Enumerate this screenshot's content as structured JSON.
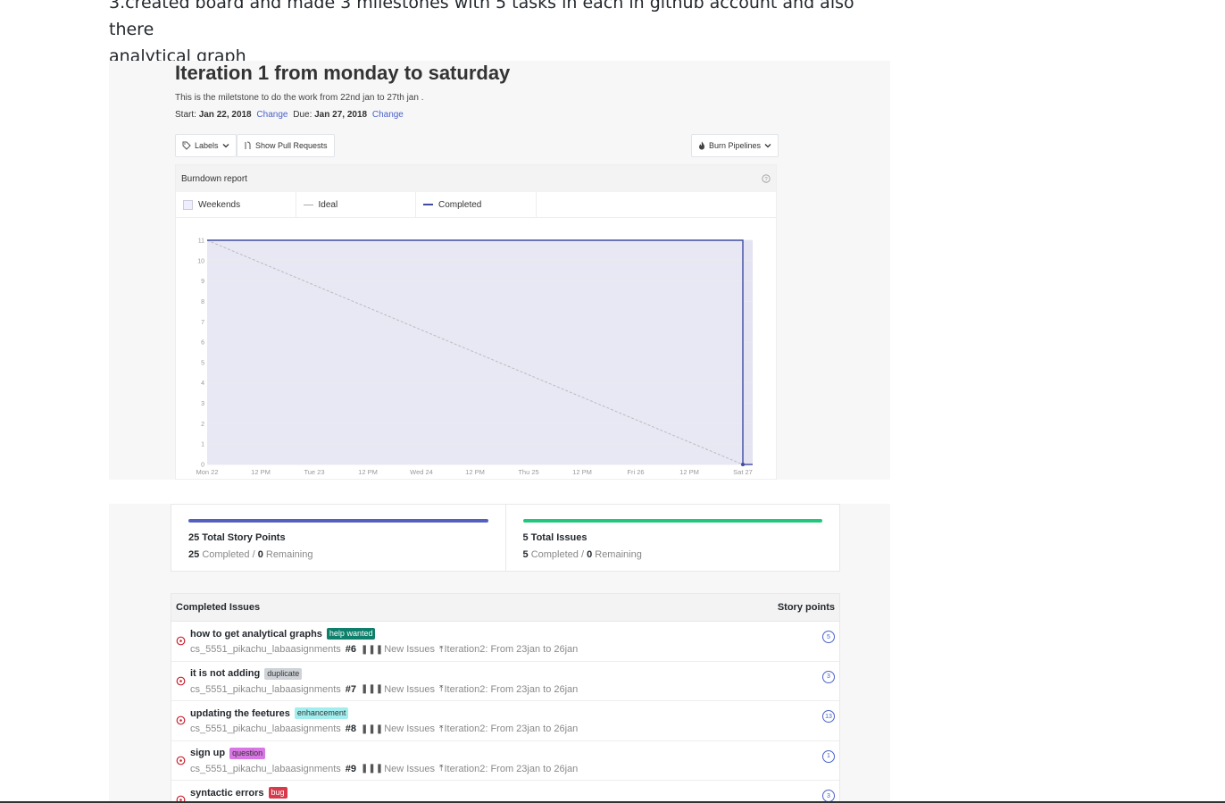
{
  "intro": {
    "line1": "3.created board and made 3 milestones with 5 tasks in each in github account and also there",
    "line2": "analytical graph"
  },
  "milestone": {
    "title": "Iteration 1 from monday to saturday",
    "description": "This is the miletstone to do the work from 22nd jan to 27th jan .",
    "start_label": "Start:",
    "start_date": "Jan 22, 2018",
    "due_label": "Due:",
    "due_date": "Jan 27, 2018",
    "change_label": "Change"
  },
  "toolbar": {
    "labels_button": "Labels",
    "show_pull_requests": "Show Pull Requests",
    "burn_pipelines": "Burn Pipelines"
  },
  "report": {
    "title": "Burndown report",
    "legend": {
      "weekends": "Weekends",
      "ideal": "Ideal",
      "completed": "Completed"
    }
  },
  "chart_data": {
    "type": "line",
    "x_ticks": [
      "Mon 22",
      "12 PM",
      "Tue 23",
      "12 PM",
      "Wed 24",
      "12 PM",
      "Thu 25",
      "12 PM",
      "Fri 26",
      "12 PM",
      "Sat 27"
    ],
    "y_ticks": [
      "0",
      "1",
      "2",
      "3",
      "4",
      "5",
      "6",
      "7",
      "8",
      "9",
      "10",
      "11"
    ],
    "ylim": [
      0,
      11
    ],
    "grid": true,
    "series": [
      {
        "name": "Ideal",
        "x": [
          "Mon 22",
          "Sat 27"
        ],
        "y": [
          11,
          0
        ]
      },
      {
        "name": "Completed",
        "x": [
          "Mon 22",
          "Sat 27",
          "Sat 27"
        ],
        "y": [
          11,
          11,
          0
        ]
      }
    ],
    "colors": {
      "ideal": "#bbbbbb",
      "completed": "#3f4aa0",
      "fill": "#e8e8f5",
      "weekend": "#e3e3f2"
    }
  },
  "stats": [
    {
      "title": "25 Total Story Points",
      "done": "25",
      "done_label": "Completed",
      "rem": "0",
      "rem_label": "Remaining",
      "progress": 1.0,
      "color": "#5460bd"
    },
    {
      "title": "5 Total Issues",
      "done": "5",
      "done_label": "Completed",
      "rem": "0",
      "rem_label": "Remaining",
      "progress": 1.0,
      "color": "#21c77c"
    }
  ],
  "issues_table": {
    "header": "Completed Issues",
    "points_header": "Story points",
    "rows": [
      {
        "title": "how to get analytical graphs",
        "tag": "help wanted",
        "tag_bg": "#0e7f6a",
        "tag_fg": "#ffffff",
        "repo": "cs_5551_pikachu_labaasignments",
        "number": "#6",
        "pipeline": "New Issues",
        "milestone": "Iteration2: From 23jan to 26jan",
        "points": "5"
      },
      {
        "title": "it is not adding",
        "tag": "duplicate",
        "tag_bg": "#cfd3d7",
        "tag_fg": "#333333",
        "repo": "cs_5551_pikachu_labaasignments",
        "number": "#7",
        "pipeline": "New Issues",
        "milestone": "Iteration2: From 23jan to 26jan",
        "points": "3"
      },
      {
        "title": "updating the feetures",
        "tag": "enhancement",
        "tag_bg": "#a2eeef",
        "tag_fg": "#333333",
        "repo": "cs_5551_pikachu_labaasignments",
        "number": "#8",
        "pipeline": "New Issues",
        "milestone": "Iteration2: From 23jan to 26jan",
        "points": "13"
      },
      {
        "title": "sign up",
        "tag": "question",
        "tag_bg": "#d876e3",
        "tag_fg": "#333333",
        "repo": "cs_5551_pikachu_labaasignments",
        "number": "#9",
        "pipeline": "New Issues",
        "milestone": "Iteration2: From 23jan to 26jan",
        "points": "1"
      },
      {
        "title": "syntactic errors",
        "tag": "bug",
        "tag_bg": "#d73a4a",
        "tag_fg": "#ffffff",
        "repo": "",
        "number": "",
        "pipeline": "",
        "milestone": "",
        "points": "3"
      }
    ]
  }
}
